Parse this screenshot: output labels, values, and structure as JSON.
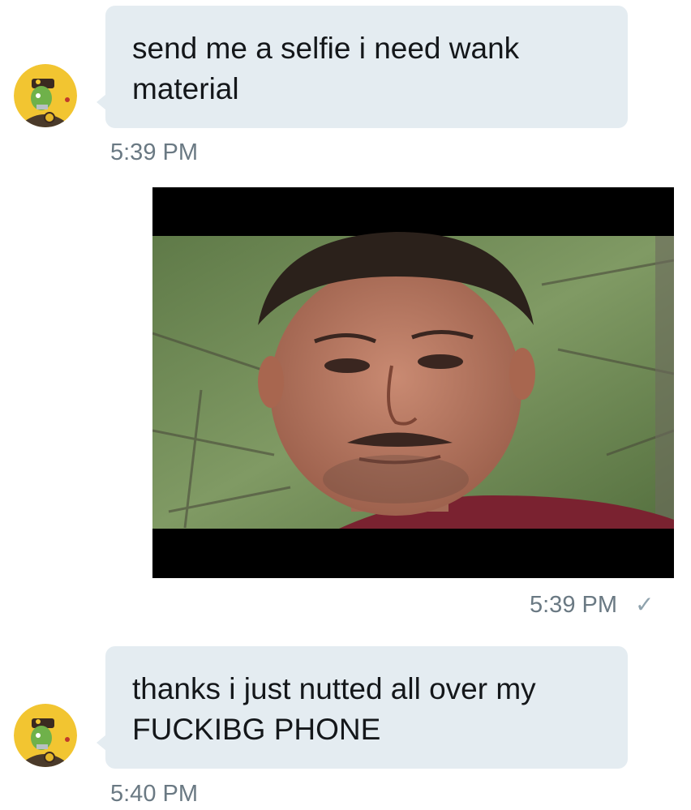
{
  "messages": [
    {
      "sender": "other",
      "lines": [
        "send me a selfie i need wank",
        "material"
      ],
      "time": "5:39 PM"
    },
    {
      "sender": "me",
      "attachment": "photo",
      "time": "5:39 PM",
      "status_icon": "✓"
    },
    {
      "sender": "other",
      "lines": [
        "thanks i just nutted all over my",
        "FUCKIBG PHONE"
      ],
      "time": "5:40 PM"
    }
  ],
  "colors": {
    "bubble": "#e4ecf1",
    "timestamp": "#6a7983",
    "text": "#14171a"
  },
  "icons": {
    "avatar": "cartoon-avatar-icon",
    "read_receipt": "checkmark-icon"
  }
}
